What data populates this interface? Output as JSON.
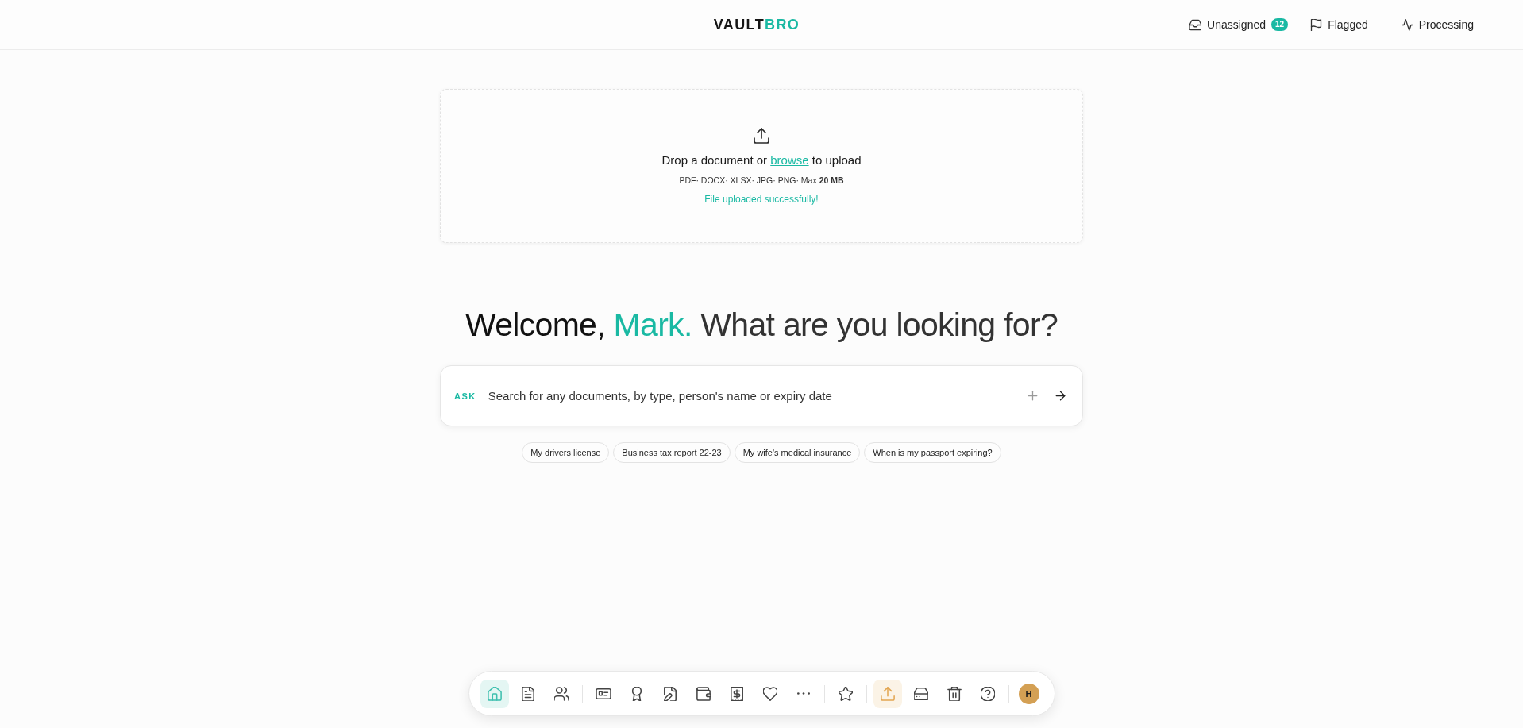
{
  "header": {
    "logo": {
      "text": "VAULT",
      "highlight": "BRO"
    },
    "nav": [
      {
        "label": "Unassigned",
        "badge": "12"
      },
      {
        "label": "Flagged"
      },
      {
        "label": "Processing"
      }
    ]
  },
  "upload": {
    "prompt_before": "Drop a document or",
    "link": "browse",
    "prompt_after": "to upload",
    "formats": "PDF· DOCX· XLSX· JPG· PNG· Max **20 MB**",
    "status": {
      "kind": "success",
      "text": "File uploaded successfully!"
    }
  },
  "welcome": {
    "greeting": "Welcome,",
    "name": "Mark.",
    "question": "What are you looking for?"
  },
  "search": {
    "prefix": "ASK",
    "placeholder": "Search for any documents, by type, person's name or expiry date"
  },
  "suggestions": [
    "My drivers license",
    "Business tax report 22-23",
    "My wife's medical insurance",
    "When is my passport expiring?"
  ],
  "dock": {
    "groups": [
      [
        {
          "selected": true,
          "highlighted": false
        },
        {
          "selected": false,
          "highlighted": false
        },
        {
          "selected": false,
          "highlighted": false
        }
      ],
      [
        {
          "selected": false,
          "highlighted": false
        },
        {
          "selected": false,
          "highlighted": false
        },
        {
          "selected": false,
          "highlighted": false
        },
        {
          "selected": false,
          "highlighted": false
        },
        {
          "selected": false,
          "highlighted": false
        },
        {
          "selected": false,
          "highlighted": false
        },
        {
          "selected": false,
          "highlighted": false
        }
      ],
      [
        {
          "selected": false,
          "highlighted": false
        }
      ],
      [
        {
          "selected": false,
          "highlighted": true
        },
        {
          "selected": false,
          "highlighted": false
        },
        {
          "selected": false,
          "highlighted": false
        },
        {
          "selected": false,
          "highlighted": false
        }
      ]
    ],
    "avatar": {
      "initial": "H"
    }
  }
}
